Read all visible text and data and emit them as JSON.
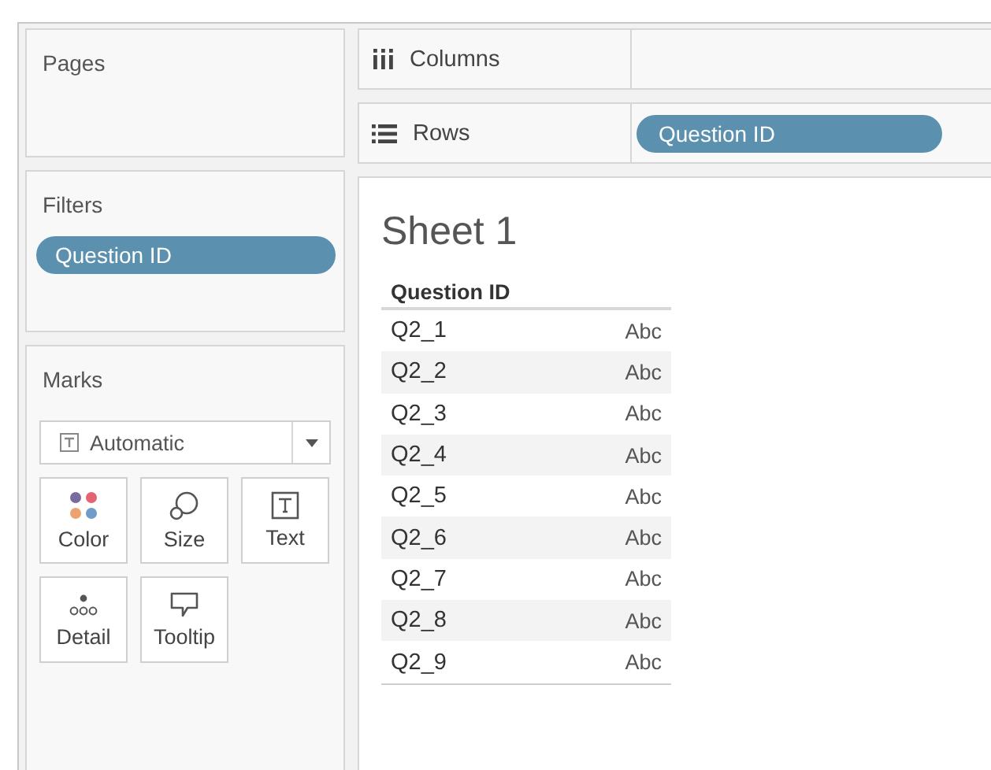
{
  "pages": {
    "title": "Pages"
  },
  "filters": {
    "title": "Filters",
    "pills": [
      "Question ID"
    ]
  },
  "marks": {
    "title": "Marks",
    "mark_type": "Automatic",
    "cards": [
      {
        "kind": "color",
        "label": "Color"
      },
      {
        "kind": "size",
        "label": "Size"
      },
      {
        "kind": "text",
        "label": "Text"
      },
      {
        "kind": "detail",
        "label": "Detail"
      },
      {
        "kind": "tooltip",
        "label": "Tooltip"
      }
    ]
  },
  "shelves": [
    {
      "kind": "columns",
      "label": "Columns"
    },
    {
      "kind": "rows",
      "label": "Rows",
      "pills": [
        "Question ID"
      ]
    }
  ],
  "sheet": {
    "title": "Sheet 1",
    "header": "Question ID",
    "rows": [
      {
        "id": "Q2_1",
        "value": "Abc"
      },
      {
        "id": "Q2_2",
        "value": "Abc"
      },
      {
        "id": "Q2_3",
        "value": "Abc"
      },
      {
        "id": "Q2_4",
        "value": "Abc"
      },
      {
        "id": "Q2_5",
        "value": "Abc"
      },
      {
        "id": "Q2_6",
        "value": "Abc"
      },
      {
        "id": "Q2_7",
        "value": "Abc"
      },
      {
        "id": "Q2_8",
        "value": "Abc"
      },
      {
        "id": "Q2_9",
        "value": "Abc"
      }
    ]
  }
}
